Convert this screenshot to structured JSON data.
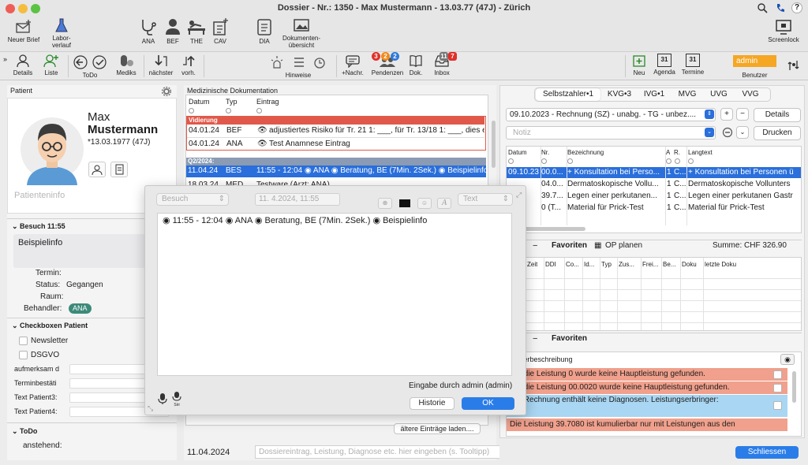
{
  "window": {
    "title": "Dossier - Nr.: 1350 - Max Mustermann - 13.03.77 (47J) - Zürich"
  },
  "toolbar1": {
    "neuer_brief": "Neuer Brief",
    "laborverlauf": "Labor-\nverlauf",
    "ana": "ANA",
    "bef": "BEF",
    "the": "THE",
    "cav": "CAV",
    "dia": "DIA",
    "dokumenten": "Dokumenten-\nübersicht",
    "screenlock": "Screenlock"
  },
  "toolbar2": {
    "details": "Details",
    "liste": "Liste",
    "todo": "ToDo",
    "mediks": "Mediks",
    "naechster": "nächster",
    "vorh": "vorh.",
    "hinweise": "Hinweise",
    "nachr": "+Nachr.",
    "pendenzen": "Pendenzen",
    "dok": "Dok.",
    "inbox": "Inbox",
    "neu": "Neu",
    "agenda": "Agenda",
    "termine": "Termine",
    "benutzer": "Benutzer",
    "user": "admin",
    "cal_day": "31",
    "badge_red": "3",
    "badge_orange": "2",
    "badge_blue": "2",
    "inbox_badge": "11",
    "inbox_badge2": "7"
  },
  "patient": {
    "section": "Patient",
    "first": "Max",
    "last": "Mustermann",
    "dob": "*13.03.1977 (47J)",
    "info_placeholder": "Patienteninfo"
  },
  "besuch": {
    "header": "Besuch 11:55",
    "text": "Beispielinfo",
    "termin_label": "Termin:",
    "status_label": "Status:",
    "status_value": "Gegangen",
    "raum_label": "Raum:",
    "behandler_label": "Behandler:",
    "behandler_value": "ANA"
  },
  "checkboxen": {
    "header": "Checkboxen Patient",
    "newsletter": "Newsletter",
    "dsgvo": "DSGVO",
    "aufmerksam": "aufmerksam d",
    "terminbestaet": "Terminbestäti",
    "text3": "Text Patient3:",
    "text4": "Text Patient4:"
  },
  "todo": {
    "header": "ToDo",
    "anstehend": "anstehend:"
  },
  "doku": {
    "section": "Medizinische Dokumentation",
    "col_datum": "Datum",
    "col_typ": "Typ",
    "col_eintrag": "Eintrag",
    "group_vid": "Vidierung",
    "rows_vid": [
      {
        "date": "04.01.24",
        "typ": "BEF",
        "text": "adjustiertes Risiko für Tr. 21 1: ___, für Tr. 13/18 1: ___, dies er"
      },
      {
        "date": "04.01.24",
        "typ": "ANA",
        "text": "Test Anamnese Eintrag"
      }
    ],
    "group_q2": "Q2/2024:",
    "selected_date": "11.04.24",
    "selected_typ": "BES",
    "selected_text": "11:55 - 12:04 ◉ ANA ◉ Beratung, BE (7Min. 2Sek.) ◉ Beispielinfo",
    "row3_date": "18.03.24",
    "row3_typ": "MED",
    "row3_text": "Testware (Arzt: ANA)",
    "older_btn": "ältere Einträge laden....",
    "entry_date": "11.04.2024",
    "entry_placeholder": "Dossiereintrag, Leistung, Diagnose etc. hier eingeben (s. Tooltipp)"
  },
  "popup": {
    "besuch": "Besuch",
    "datetime": "11.  4.2024, 11:55",
    "text_select": "Text",
    "content": "◉ 11:55 - 12:04 ◉ ANA ◉ Beratung, BE (7Min. 2Sek.) ◉ Beispielinfo",
    "eingabe": "Eingabe durch admin (admin)",
    "historie": "Historie",
    "ok": "OK",
    "siri": "Siri"
  },
  "billing": {
    "tabs": [
      "Selbstzahler•1",
      "KVG•3",
      "IVG•1",
      "MVG",
      "UVG",
      "VVG"
    ],
    "invoice": "09.10.2023 - Rechnung (SZ) - unabg. - TG - unbez....",
    "details_btn": "Details",
    "notiz_placeholder": "Notiz",
    "drucken_btn": "Drucken",
    "cols": [
      "Datum",
      "Nr.",
      "Bezeichnung",
      "A",
      "R.",
      "Langtext"
    ],
    "rows": [
      [
        "09.10.23",
        "00.0...",
        "+ Konsultation bei Perso...",
        "1",
        "C...",
        "+ Konsultation bei Personen ü"
      ],
      [
        "",
        "04.0...",
        "Dermatoskopische Vollu...",
        "1",
        "C...",
        "Dermatoskopische Vollunters"
      ],
      [
        "",
        "39.7...",
        "Legen einer perkutanen...",
        "1",
        "C...",
        "Legen einer perkutanen Gastr"
      ],
      [
        "",
        "0 (T...",
        "Material für Prick-Test",
        "1",
        "C...",
        "Material für Prick-Test"
      ]
    ],
    "favoriten": "Favoriten",
    "op_planen": "OP planen",
    "summe": "Summe: CHF 326.90",
    "cols2": [
      "Zeit",
      "DDI",
      "Co...",
      "Id...",
      "Typ",
      "Zus...",
      "Frei...",
      "Be...",
      "Doku",
      "letzte Doku"
    ],
    "favoriten2": "Favoriten",
    "fehler_header": "Fehlerbeschreibung",
    "warnings": [
      {
        "text": "Für die Leistung 0 wurde keine Hauptleistung gefunden.",
        "color": "#f0a08c"
      },
      {
        "text": "Für die Leistung 00.0020 wurde keine Hauptleistung gefunden.",
        "color": "#f0a08c"
      },
      {
        "text": "Die Rechnung enthält keine Diagnosen. Leistungserbringer:",
        "color": "#a9d6f2"
      },
      {
        "text": "ANA",
        "color": "#a9d6f2"
      },
      {
        "text": "Die Leistung 39.7080 ist kumulierbar nur mit Leistungen aus den",
        "color": "#f0a08c"
      }
    ],
    "schliessen": "Schliessen"
  },
  "colors": {
    "accent": "#1e6fe0",
    "red": "#e0584a",
    "selection": "#2a6fdb"
  }
}
